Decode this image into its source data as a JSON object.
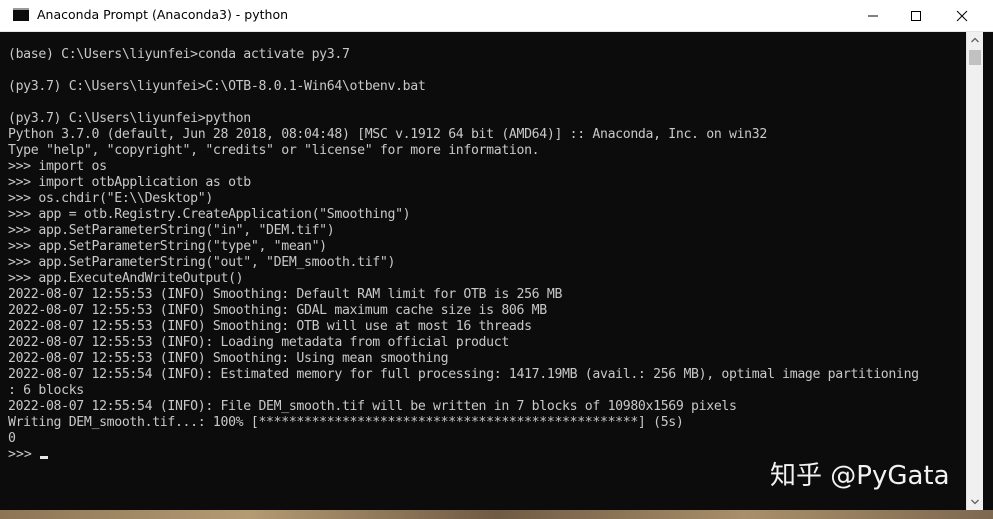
{
  "window": {
    "title": "Anaconda Prompt (Anaconda3) - python",
    "icon": "console-icon"
  },
  "controls": {
    "minimize_icon": "minimize-icon",
    "maximize_icon": "maximize-icon",
    "close_icon": "close-icon"
  },
  "console": {
    "lines": [
      "(base) C:\\Users\\liyunfei>conda activate py3.7",
      "",
      "(py3.7) C:\\Users\\liyunfei>C:\\OTB-8.0.1-Win64\\otbenv.bat",
      "",
      "(py3.7) C:\\Users\\liyunfei>python",
      "Python 3.7.0 (default, Jun 28 2018, 08:04:48) [MSC v.1912 64 bit (AMD64)] :: Anaconda, Inc. on win32",
      "Type \"help\", \"copyright\", \"credits\" or \"license\" for more information.",
      ">>> import os",
      ">>> import otbApplication as otb",
      ">>> os.chdir(\"E:\\\\Desktop\")",
      ">>> app = otb.Registry.CreateApplication(\"Smoothing\")",
      ">>> app.SetParameterString(\"in\", \"DEM.tif\")",
      ">>> app.SetParameterString(\"type\", \"mean\")",
      ">>> app.SetParameterString(\"out\", \"DEM_smooth.tif\")",
      ">>> app.ExecuteAndWriteOutput()",
      "2022-08-07 12:55:53 (INFO) Smoothing: Default RAM limit for OTB is 256 MB",
      "2022-08-07 12:55:53 (INFO) Smoothing: GDAL maximum cache size is 806 MB",
      "2022-08-07 12:55:53 (INFO) Smoothing: OTB will use at most 16 threads",
      "2022-08-07 12:55:53 (INFO): Loading metadata from official product",
      "2022-08-07 12:55:53 (INFO) Smoothing: Using mean smoothing",
      "2022-08-07 12:55:54 (INFO): Estimated memory for full processing: 1417.19MB (avail.: 256 MB), optimal image partitioning",
      ": 6 blocks",
      "2022-08-07 12:55:54 (INFO): File DEM_smooth.tif will be written in 7 blocks of 10980x1569 pixels",
      "Writing DEM_smooth.tif...: 100% [**************************************************] (5s)",
      "0"
    ],
    "prompt": ">>> "
  },
  "scrollbar": {
    "up_icon": "scroll-up-arrow-icon",
    "down_icon": "scroll-down-arrow-icon"
  },
  "watermark": {
    "text": "知乎 @PyGata"
  }
}
